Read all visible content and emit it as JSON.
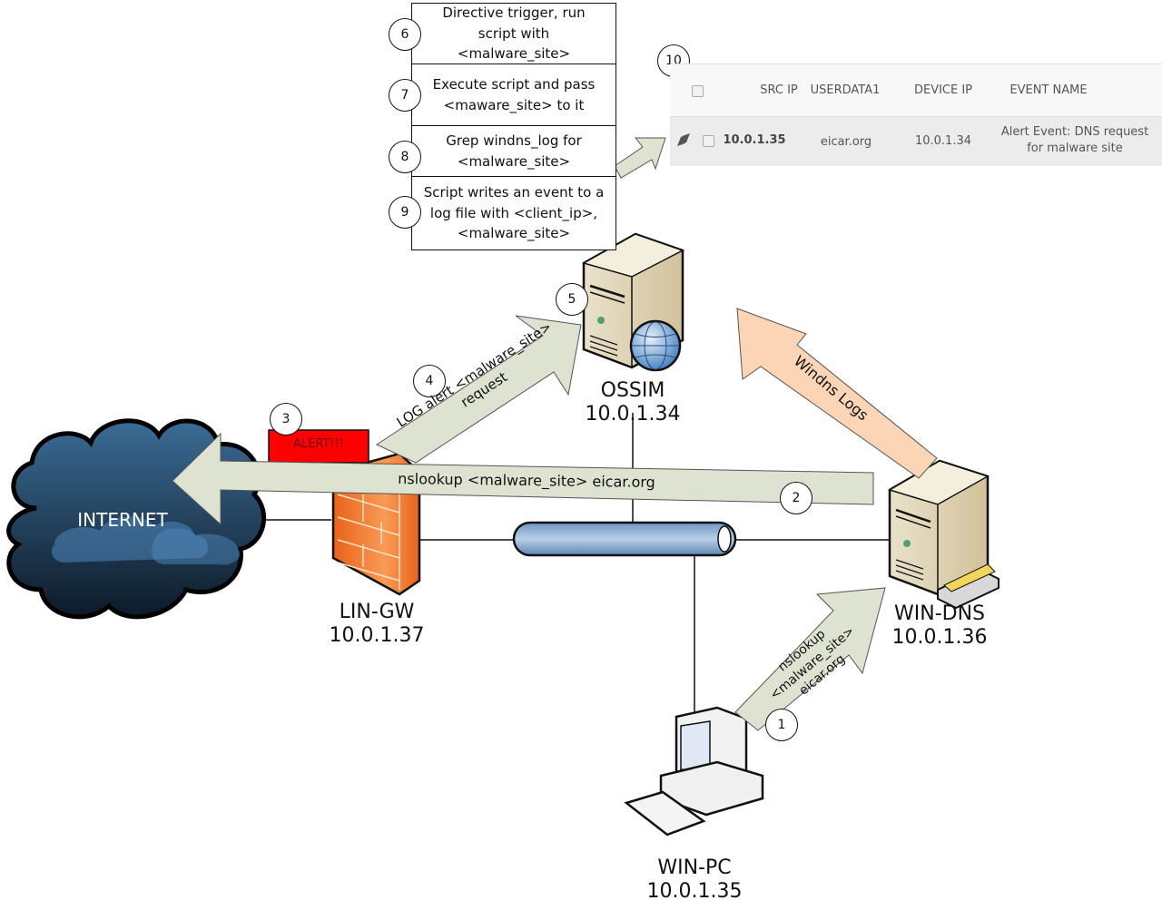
{
  "steps": [
    {
      "number": "1",
      "text": "nslookup <malware_site> eicar.org"
    },
    {
      "number": "2",
      "text": "nslookup <malware_site> eicar.org"
    },
    {
      "number": "3",
      "text": "ALERT!!!"
    },
    {
      "number": "4",
      "text": "LOG alert <malware_site> request"
    },
    {
      "number": "5",
      "text": ""
    },
    {
      "number": "6",
      "text": "Directive trigger, run script with <malware_site>"
    },
    {
      "number": "7",
      "text": "Execute script and pass <maware_site> to it"
    },
    {
      "number": "8",
      "text": "Grep windns_log for <malware_site>"
    },
    {
      "number": "9",
      "text": "Script writes an event to a log file with <client_ip>, <malware_site>"
    },
    {
      "number": "10",
      "text": ""
    }
  ],
  "step_boxes": {
    "s6_l1": "Directive trigger, run",
    "s6_l2": "script with",
    "s6_l3": "<malware_site>",
    "s7_l1": "Execute script and pass",
    "s7_l2": "<maware_site> to it",
    "s8_l1": "Grep windns_log for",
    "s8_l2": "<malware_site>",
    "s9_l1": "Script writes an event to a",
    "s9_l2": "log file with <client_ip>,",
    "s9_l3": "<malware_site>"
  },
  "nodes": {
    "internet": {
      "name": "INTERNET"
    },
    "gateway": {
      "name": "LIN-GW",
      "ip": "10.0.1.37"
    },
    "ossim": {
      "name": "OSSIM",
      "ip": "10.0.1.34"
    },
    "dns": {
      "name": "WIN-DNS",
      "ip": "10.0.1.36"
    },
    "pc": {
      "name": "WIN-PC",
      "ip": "10.0.1.35"
    }
  },
  "arrows": {
    "a1_l1": "nslookup",
    "a1_l2": "<malware_site>",
    "a1_l3": "eicar.org",
    "a2": "nslookup <malware_site> eicar.org",
    "a4_l1": "LOG alert <malware_site>",
    "a4_l2": "request",
    "windns": "Windns Logs"
  },
  "alert_label": "ALERT!!!",
  "siem_table": {
    "columns": [
      "SRC IP",
      "USERDATA1",
      "DEVICE IP",
      "EVENT NAME"
    ],
    "rows": [
      {
        "src_ip": "10.0.1.35",
        "userdata1": "eicar.org",
        "device_ip": "10.0.1.34",
        "event_l1": "Alert Event: DNS request",
        "event_l2": "for malware site"
      }
    ]
  },
  "colors": {
    "arrow_green": "#dde3d0",
    "arrow_orange": "#fbd5b5",
    "alert_red": "#ff0000",
    "firewall_orange": "#f07a2a",
    "cloud_blue": "#2b4a66",
    "bus_blue": "#8fb1d6"
  }
}
